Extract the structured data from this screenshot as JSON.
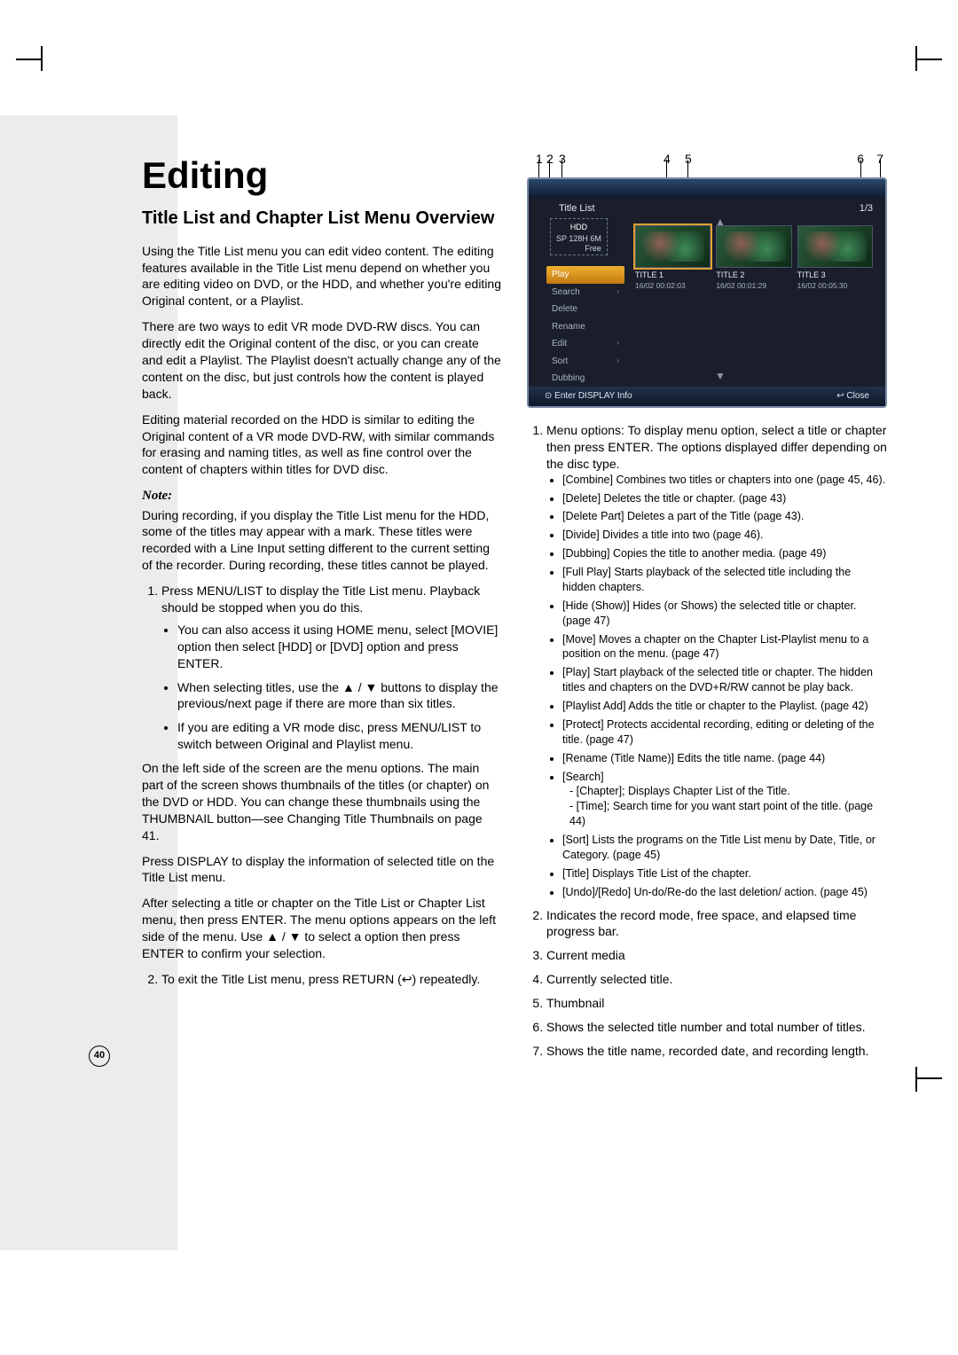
{
  "page_number": "40",
  "h1": "Editing",
  "h2": "Title List and Chapter List Menu Overview",
  "left": {
    "p1": "Using the Title List menu you can edit video content. The editing features available in the Title List menu depend on whether you are editing video on DVD, or the HDD, and whether you're editing Original content, or a Playlist.",
    "p2": "There are two ways to edit VR mode DVD-RW discs. You can directly edit the Original content of the disc, or you can create and edit a Playlist. The Playlist doesn't actually change any of the content on the disc, but just controls how the content is played back.",
    "p3": "Editing material recorded on the HDD is similar to editing the Original content of a VR mode DVD-RW, with similar commands for erasing and naming titles, as well as fine control over the content of chapters within titles for DVD disc.",
    "note_hd": "Note:",
    "note": "During recording, if you display the Title List menu for the HDD, some of the titles may appear with a mark. These titles were recorded with a Line Input setting different to the current setting of the recorder. During recording, these titles cannot be played.",
    "ol1_li1": "Press MENU/LIST to display the Title List menu. Playback should be stopped when you do this.",
    "ol1_li1_b1": "You can also access it using HOME menu, select [MOVIE] option then select [HDD] or [DVD] option and press ENTER.",
    "ol1_li1_b2": "When selecting titles, use the ▲ / ▼ buttons to display the previous/next page if there are more than six titles.",
    "ol1_li1_b3": "If you are editing a VR mode disc, press MENU/LIST to switch between Original and Playlist menu.",
    "p4": "On the left side of the screen are the menu options. The main part of the screen shows thumbnails of the titles (or chapter) on the DVD or HDD. You can change these thumbnails using the THUMBNAIL button—see Changing Title Thumbnails on page 41.",
    "p5": "Press DISPLAY to display the information of selected title on the Title List menu.",
    "p6": "After selecting a title or chapter on the Title List or Chapter List menu, then press ENTER. The menu options appears on the left side of the menu. Use ▲ / ▼ to select a option then press ENTER to confirm your selection.",
    "ol1_li2": "To exit the Title List menu, press RETURN (↩) repeatedly."
  },
  "callouts": {
    "c1": "1",
    "c2": "2",
    "c3": "3",
    "c4": "4",
    "c5": "5",
    "c6": "6",
    "c7": "7"
  },
  "osd": {
    "title": "Title List",
    "count": "1/3",
    "media_label": "HDD",
    "media_line": "SP   128H 6M",
    "media_free": "Free",
    "menu": [
      "Play",
      "Search",
      "Delete",
      "Rename",
      "Edit",
      "Sort",
      "Dubbing"
    ],
    "thumbs": [
      {
        "name": "TITLE 1",
        "meta": "16/02   00:02:03"
      },
      {
        "name": "TITLE 2",
        "meta": "16/02   00:01:29"
      },
      {
        "name": "TITLE 3",
        "meta": "16/02   00:05:30"
      }
    ],
    "bottom_left": "⊙ Enter  DISPLAY Info",
    "bottom_right": "↩ Close"
  },
  "right": {
    "ol": [
      "Menu options: To display menu option, select a title or chapter then press ENTER. The options displayed differ depending on the disc type.",
      "Indicates the record mode, free space, and elapsed time progress bar.",
      "Current media",
      "Currently selected title.",
      "Thumbnail",
      "Shows the selected title number and total number of titles.",
      "Shows the title name, recorded date, and recording length."
    ],
    "opts": [
      "[Combine] Combines two titles or chapters into one (page 45, 46).",
      "[Delete] Deletes the title or chapter. (page 43)",
      "[Delete Part] Deletes a part of the Title (page 43).",
      "[Divide] Divides a title into two (page 46).",
      "[Dubbing] Copies the title to another media. (page 49)",
      "[Full Play] Starts playback of the selected title including the hidden chapters.",
      "[Hide (Show)] Hides (or Shows) the selected title or chapter. (page 47)",
      "[Move] Moves a chapter on the Chapter List-Playlist menu to a position on the menu. (page 47)",
      "[Play] Start playback of the selected title or chapter. The hidden titles and chapters on the DVD+R/RW cannot be play back.",
      "[Playlist Add] Adds the title or chapter to the Playlist. (page 42)",
      "[Protect] Protects accidental recording, editing or deleting of the title. (page 47)",
      "[Rename (Title Name)] Edits the title name. (page 44)",
      "[Search]",
      "[Sort] Lists the programs on the Title List menu by Date, Title, or Category. (page 45)",
      "[Title] Displays Title List of the chapter.",
      "[Undo]/[Redo] Un-do/Re-do the last deletion/ action. (page 45)"
    ],
    "search_sub": [
      "- [Chapter]; Displays Chapter List of the Title.",
      "- [Time]; Search time for you want start point of the title. (page 44)"
    ]
  }
}
